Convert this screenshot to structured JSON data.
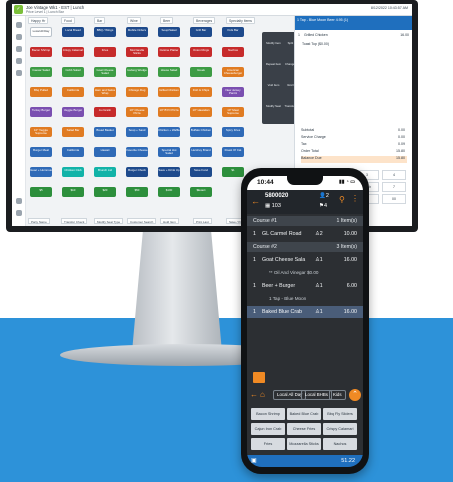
{
  "app": {
    "top_title": "Joe Vintage Wk1 - EST | Lunch",
    "top_sub": "Price Level 1 | Lunch Bar",
    "top_right": "8/12/2022 10:43:57 AM"
  },
  "tabs": [
    "Happy Hr",
    "Food",
    "Bar",
    "Wine",
    "Beer",
    "Beverages",
    "Specialty Items"
  ],
  "tiles": [
    {
      "label": "Local All Day",
      "color": "#ffffff",
      "text": "#1f2933"
    },
    {
      "label": "Local Bread",
      "color": "#1e4a8c"
    },
    {
      "label": "BBQ / Wings",
      "color": "#1e4a8c"
    },
    {
      "label": "Mobile Orders",
      "color": "#1e4a8c"
    },
    {
      "label": "Soup/Salad",
      "color": "#1e4a8c"
    },
    {
      "label": "Grill Bar",
      "color": "#1e4a8c"
    },
    {
      "label": "Kids Bar",
      "color": "#1e4a8c"
    },
    {
      "label": "Bacon Shrimp",
      "color": "#c62b2b"
    },
    {
      "label": "Crispy Calamari",
      "color": "#c62b2b"
    },
    {
      "label": "Fries",
      "color": "#c62b2b"
    },
    {
      "label": "Mozzarella Sticks",
      "color": "#c62b2b"
    },
    {
      "label": "Cuisine Platter",
      "color": "#c62b2b"
    },
    {
      "label": "Onion Rings",
      "color": "#c62b2b"
    },
    {
      "label": "Nachos",
      "color": "#c62b2b"
    },
    {
      "label": "Caesar Salad",
      "color": "#3d9c45"
    },
    {
      "label": "Cobb Salad",
      "color": "#3d9c45"
    },
    {
      "label": "Goat Cheese Salad",
      "color": "#3d9c45"
    },
    {
      "label": "Iceberg Wedge",
      "color": "#3d9c45"
    },
    {
      "label": "House Salad",
      "color": "#3d9c45"
    },
    {
      "label": "Greek",
      "color": "#3d9c45"
    },
    {
      "label": "American Cheeseburger",
      "color": "#e07b22"
    },
    {
      "label": "Bbq Pulled",
      "color": "#e07b22"
    },
    {
      "label": "California",
      "color": "#e07b22"
    },
    {
      "label": "Ham and Swiss Wrap",
      "color": "#e07b22"
    },
    {
      "label": "Chicago Dog",
      "color": "#e07b22"
    },
    {
      "label": "Grilled Chicken",
      "color": "#e07b22"
    },
    {
      "label": "Fish & Chips",
      "color": "#e07b22"
    },
    {
      "label": "New Jersey Panini",
      "color": "#7a4fb0"
    },
    {
      "label": "Turkey Burger",
      "color": "#7a4fb0"
    },
    {
      "label": "Veggie Burger",
      "color": "#7a4fb0"
    },
    {
      "label": "Au Gratin",
      "color": "#c62b2b"
    },
    {
      "label": "10\" Cheese Pizza",
      "color": "#e07b22"
    },
    {
      "label": "10\" BYO Pizza",
      "color": "#e07b22"
    },
    {
      "label": "10\" Hawaiian",
      "color": "#e07b22"
    },
    {
      "label": "10\" Meat Supreme",
      "color": "#e07b22"
    },
    {
      "label": "10\" Veggie Supreme",
      "color": "#e07b22"
    },
    {
      "label": "Salad Bar",
      "color": "#e07b22"
    },
    {
      "label": "Bread Basket",
      "color": "#2f6ab7"
    },
    {
      "label": "Soup + Sand",
      "color": "#2f6ab7"
    },
    {
      "label": "Chicken + Waffle",
      "color": "#2f6ab7"
    },
    {
      "label": "Buffalo Chicken",
      "color": "#2f6ab7"
    },
    {
      "label": "Spicy Fries",
      "color": "#2f6ab7"
    },
    {
      "label": "Burger Meal",
      "color": "#2f6ab7"
    },
    {
      "label": "California",
      "color": "#2f6ab7"
    },
    {
      "label": "Hawaii",
      "color": "#2f6ab7"
    },
    {
      "label": "Favorite Cheese",
      "color": "#2f6ab7"
    },
    {
      "label": "Special Hot Salad",
      "color": "#2f6ab7"
    },
    {
      "label": "Hershey Brand",
      "color": "#2f6ab7"
    },
    {
      "label": "Roast Of Cat",
      "color": "#2f6ab7"
    },
    {
      "label": "Guac + Hummus",
      "color": "#2f6ab7"
    },
    {
      "label": "Chicken Club",
      "color": "#12b3a8"
    },
    {
      "label": "Brunch Ltd",
      "color": "#12b3a8"
    },
    {
      "label": "Burger Check",
      "color": "#1e4a8c"
    },
    {
      "label": "Save + Drink Up",
      "color": "#1e4a8c"
    },
    {
      "label": "Save Fund",
      "color": "#1e4a8c"
    },
    {
      "label": "$1",
      "color": "#2d8f3c"
    },
    {
      "label": "$5",
      "color": "#2d8f3c"
    },
    {
      "label": "$10",
      "color": "#2d8f3c"
    },
    {
      "label": "$20",
      "color": "#2d8f3c"
    },
    {
      "label": "$50",
      "color": "#2d8f3c"
    },
    {
      "label": "$100",
      "color": "#2d8f3c"
    },
    {
      "label": "$Exact",
      "color": "#2d8f3c"
    }
  ],
  "popup_buttons": [
    "Modify Item",
    "Split Item",
    "Reorder",
    "Repeat Item",
    "Change Price",
    "Discount",
    "Void Item",
    "Void Items",
    "Hold Item",
    "Modify Seat",
    "Transfer Items",
    "Course"
  ],
  "order_panel": {
    "head": "1 Tap - Blue Moon Beer 4.95 (1)",
    "rows": [
      {
        "qty": "1",
        "name": "Grilled Chicken",
        "price": "16.00"
      },
      {
        "qty": "",
        "name": "Toast Top ($0.00)",
        "price": ""
      }
    ],
    "totals": [
      {
        "label": "Subtotal",
        "value": "0.00"
      },
      {
        "label": "Service Charge",
        "value": "0.00"
      },
      {
        "label": "Tax",
        "value": "0.09"
      },
      {
        "label": "Order Total",
        "value": "15.80"
      },
      {
        "label": "Balance Due",
        "value": "15.80"
      }
    ]
  },
  "keypad": [
    "1",
    "2",
    "3",
    "4",
    "5",
    "6",
    "Cash",
    "7",
    "8",
    "9",
    "0",
    "00",
    "Card"
  ],
  "bottom_tabs": [
    "Party Name",
    "Transfer Check",
    "Modify Seat Type",
    "Customer Search",
    "Hold Item",
    "Print Last",
    "Save / Pay"
  ],
  "phone": {
    "time": "10:44",
    "check_no": "5800020",
    "guests": "2",
    "table": "103",
    "seats": "4",
    "courses": [
      {
        "label": "Course #1",
        "count": "1 Item(s)"
      },
      {
        "label": "Course #2",
        "count": "3 Item(s)"
      }
    ],
    "items": [
      {
        "qty": "1",
        "name": "GL Carmel Road",
        "seat": "2",
        "price": "10.00"
      },
      {
        "qty": "1",
        "name": "Goat Cheese Sala",
        "seat": "1",
        "price": "16.00"
      },
      {
        "qty": "1",
        "name": "Beer + Burger",
        "seat": "1",
        "price": "6.00"
      },
      {
        "qty": "1",
        "name": "Baked Blue Crab",
        "seat": "1",
        "price": "16.00"
      }
    ],
    "notes": [
      "** Oil And Vinegar $0.00",
      "1 Tap - Blue Moon"
    ],
    "nav_chips": [
      "Local All Day",
      "Local BHBs",
      "Kids"
    ],
    "grid": [
      "Bacon Shrimp",
      "Baked Blue Crab Dip",
      "Bbq Fly Sliders",
      "Cajun Iron Crab Cake",
      "Cheese Fries",
      "Crispy Calamari",
      "Fries",
      "Mozzarella Sticks",
      "Nachos"
    ],
    "total": "51.22"
  },
  "colors": {
    "accent": "#1f6fbe",
    "orange": "#f08a24",
    "desk": "#2d92d9"
  }
}
